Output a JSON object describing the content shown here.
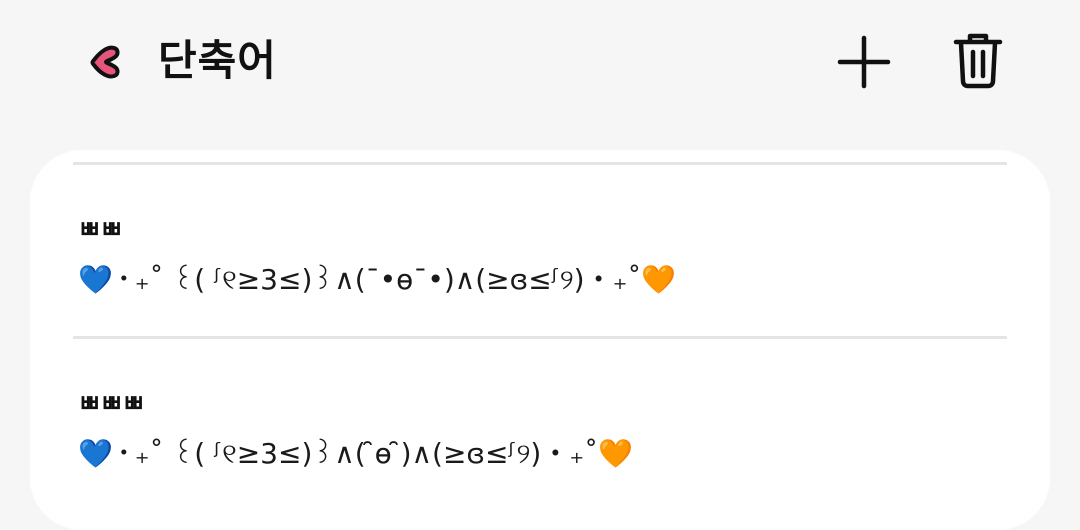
{
  "header": {
    "title": "단축어",
    "back_icon": "heart-back-icon",
    "add_icon": "plus-icon",
    "delete_icon": "trash-icon",
    "accent_color": "#e8557a"
  },
  "shortcuts": [
    {
      "short": "ㅃㅃ",
      "expanded": "💙・₊˚ ꒰( ᶴ୧≥3≤)꒱∧(¯•ɵ¯•)∧(≥ɞ≤ᶴ୨)・₊˚🧡"
    },
    {
      "short": "ㅃㅃㅃ",
      "expanded": "💙・₊˚ ꒰( ᶴ୧≥3≤)꒱∧( ̑ɵ ̑)∧(≥ɞ≤ᶴ୨)・₊˚🧡"
    }
  ]
}
